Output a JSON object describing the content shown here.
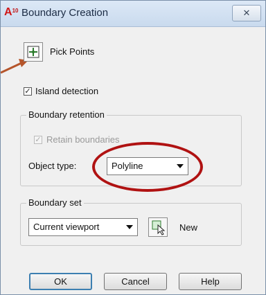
{
  "window": {
    "title": "Boundary Creation",
    "close_label": "☒"
  },
  "pick_points": {
    "label": "Pick Points"
  },
  "island_detection": {
    "label": "Island detection",
    "checked": true
  },
  "boundary_retention": {
    "group_label": "Boundary retention",
    "retain_label": "Retain boundaries",
    "retain_checked": true,
    "object_type_label": "Object type:",
    "object_type_value": "Polyline"
  },
  "boundary_set": {
    "group_label": "Boundary set",
    "set_value": "Current viewport",
    "new_label": "New"
  },
  "buttons": {
    "ok": "OK",
    "cancel": "Cancel",
    "help": "Help"
  },
  "colors": {
    "annotation_red": "#b01212",
    "arrow": "#b5552b"
  }
}
